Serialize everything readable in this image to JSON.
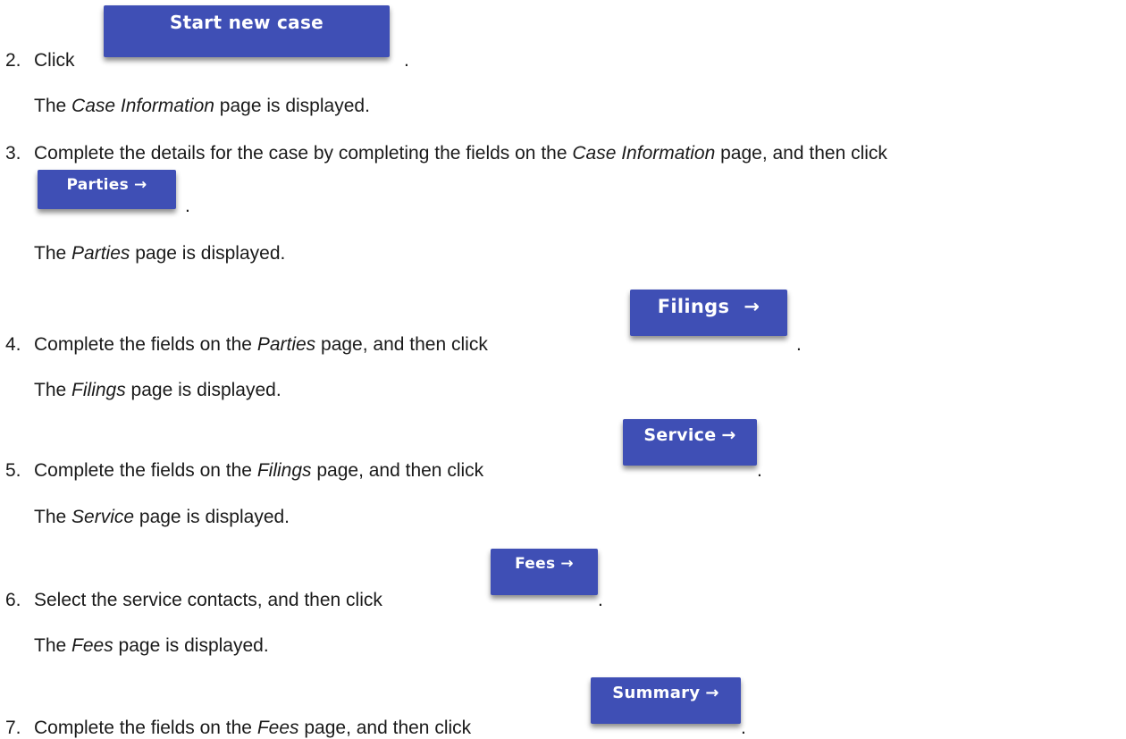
{
  "steps": [
    {
      "number": "2.",
      "prefix": "Click",
      "suffix": ".",
      "button": {
        "label": "Start new case"
      },
      "result": {
        "before": "The ",
        "page": "Case Information",
        "after": " page is displayed."
      }
    },
    {
      "number": "3.",
      "prefix": "Complete the details for the case by completing the fields on the ",
      "page": "Case Information",
      "suffix": " page, and then click",
      "period": ".",
      "button": {
        "label": "Parties",
        "arrow": "→"
      },
      "result": {
        "before": "The ",
        "page": "Parties",
        "after": " page is displayed."
      }
    },
    {
      "number": "4.",
      "prefix": "Complete the fields on the ",
      "page": "Parties",
      "suffix": " page, and then click",
      "period": ".",
      "button": {
        "label": "Filings",
        "arrow": "→"
      },
      "result": {
        "before": "The ",
        "page": "Filings",
        "after": " page is displayed."
      }
    },
    {
      "number": "5.",
      "prefix": "Complete the fields on the ",
      "page": "Filings",
      "suffix": " page, and then click",
      "period": ".",
      "button": {
        "label": "Service",
        "arrow": "→"
      },
      "result": {
        "before": "The ",
        "page": "Service",
        "after": " page is displayed."
      }
    },
    {
      "number": "6.",
      "prefix": "Select the service contacts, and then click",
      "period": ".",
      "button": {
        "label": "Fees",
        "arrow": "→"
      },
      "result": {
        "before": "The ",
        "page": "Fees",
        "after": " page is displayed."
      }
    },
    {
      "number": "7.",
      "prefix": "Complete the fields on the ",
      "page": "Fees",
      "suffix": " page, and then click",
      "period": ".",
      "button": {
        "label": "Summary",
        "arrow": "→"
      }
    }
  ]
}
